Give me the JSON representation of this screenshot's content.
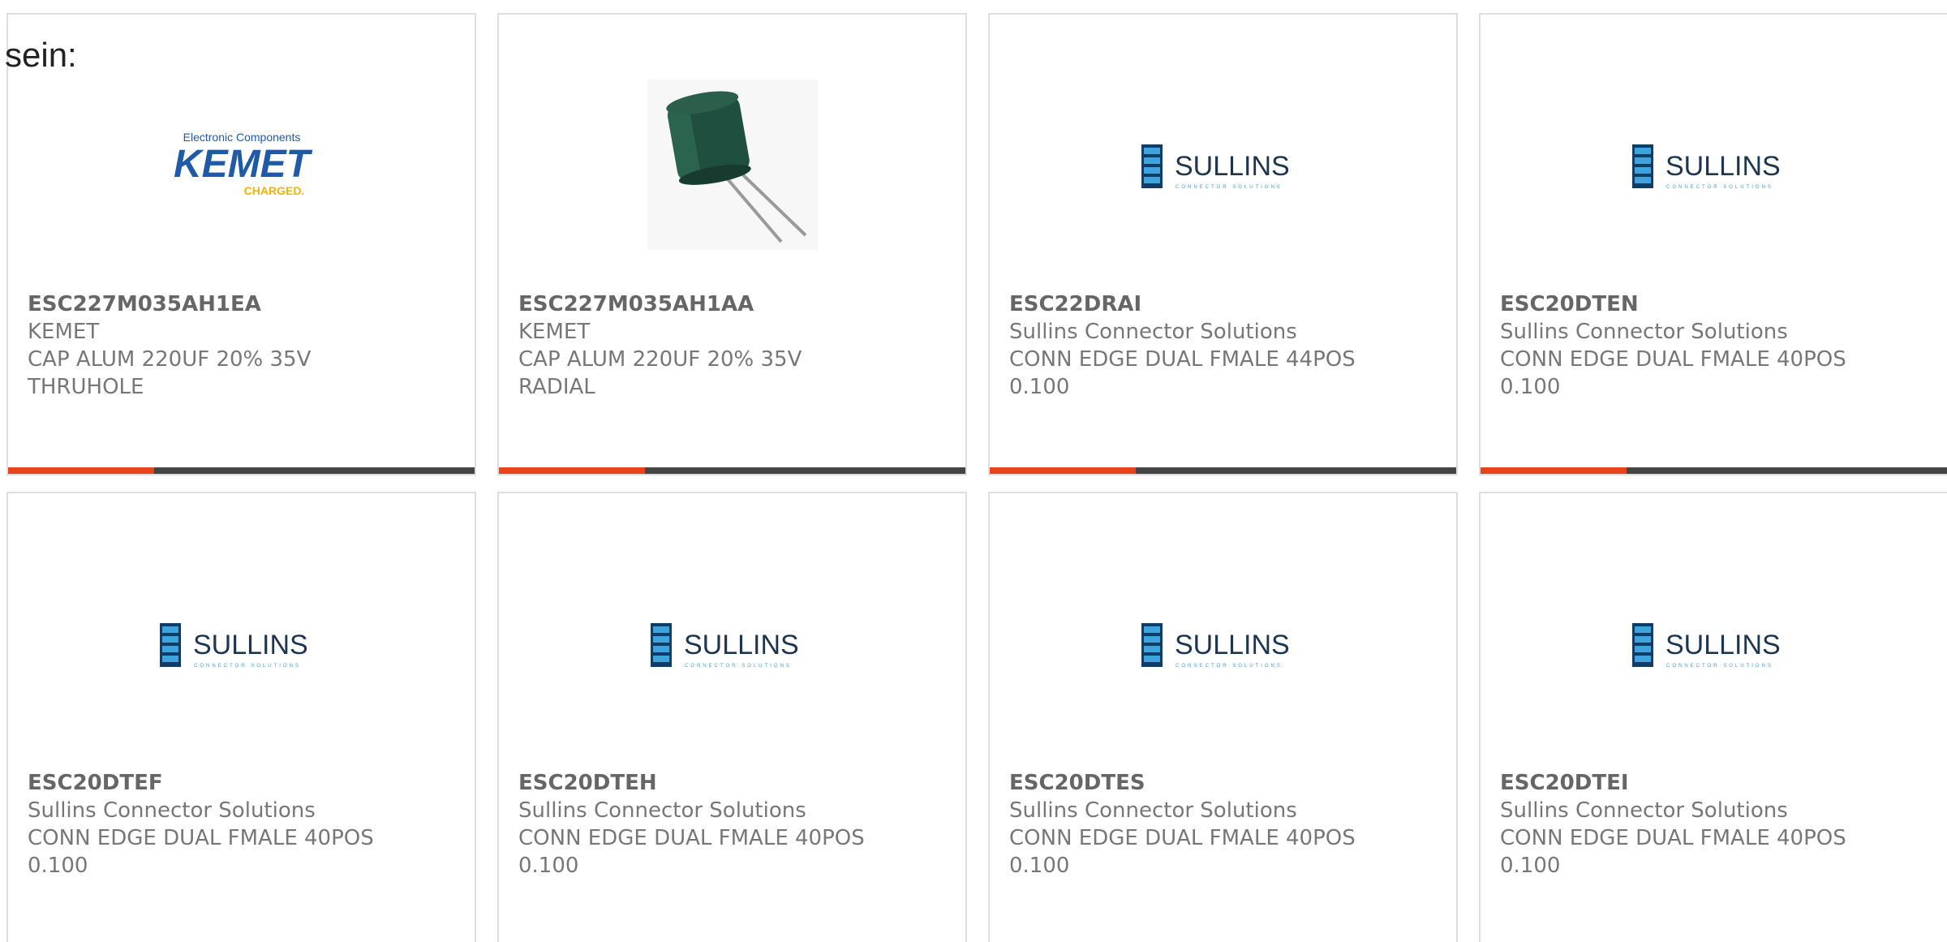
{
  "intro_text": "sein:",
  "products": [
    {
      "part_number": "ESC227M035AH1EA",
      "manufacturer": "KEMET",
      "desc_line1": "CAP ALUM 220UF 20% 35V",
      "desc_line2": "THRUHOLE",
      "image": "kemet-logo",
      "logo": {
        "top": "Electronic Components",
        "main": "KEMET",
        "sub": "CHARGED."
      }
    },
    {
      "part_number": "ESC227M035AH1AA",
      "manufacturer": "KEMET",
      "desc_line1": "CAP ALUM 220UF 20% 35V",
      "desc_line2": "RADIAL",
      "image": "capacitor-photo"
    },
    {
      "part_number": "ESC22DRAI",
      "manufacturer": "Sullins Connector Solutions",
      "desc_line1": "CONN EDGE DUAL FMALE 44POS",
      "desc_line2": "0.100",
      "image": "sullins-logo",
      "logo": {
        "main": "SULLINS",
        "sub": "CONNECTOR SOLUTIONS"
      }
    },
    {
      "part_number": "ESC20DTEN",
      "manufacturer": "Sullins Connector Solutions",
      "desc_line1": "CONN EDGE DUAL FMALE 40POS",
      "desc_line2": "0.100",
      "image": "sullins-logo",
      "logo": {
        "main": "SULLINS",
        "sub": "CONNECTOR SOLUTIONS"
      }
    },
    {
      "part_number": "ESC20DTEF",
      "manufacturer": "Sullins Connector Solutions",
      "desc_line1": "CONN EDGE DUAL FMALE 40POS",
      "desc_line2": "0.100",
      "image": "sullins-logo",
      "logo": {
        "main": "SULLINS",
        "sub": "CONNECTOR SOLUTIONS"
      }
    },
    {
      "part_number": "ESC20DTEH",
      "manufacturer": "Sullins Connector Solutions",
      "desc_line1": "CONN EDGE DUAL FMALE 40POS",
      "desc_line2": "0.100",
      "image": "sullins-logo",
      "logo": {
        "main": "SULLINS",
        "sub": "CONNECTOR SOLUTIONS"
      }
    },
    {
      "part_number": "ESC20DTES",
      "manufacturer": "Sullins Connector Solutions",
      "desc_line1": "CONN EDGE DUAL FMALE 40POS",
      "desc_line2": "0.100",
      "image": "sullins-logo",
      "logo": {
        "main": "SULLINS",
        "sub": "CONNECTOR SOLUTIONS"
      }
    },
    {
      "part_number": "ESC20DTEI",
      "manufacturer": "Sullins Connector Solutions",
      "desc_line1": "CONN EDGE DUAL FMALE 40POS",
      "desc_line2": "0.100",
      "image": "sullins-logo",
      "logo": {
        "main": "SULLINS",
        "sub": "CONNECTOR SOLUTIONS"
      }
    }
  ],
  "colors": {
    "accent": "#e8441c",
    "bar_dark": "#444444",
    "card_border": "#dedede",
    "text": "#777777",
    "kemet_blue": "#1e5aa8",
    "kemet_yellow": "#f4b400",
    "sullins_blue": "#1a6fb0"
  }
}
